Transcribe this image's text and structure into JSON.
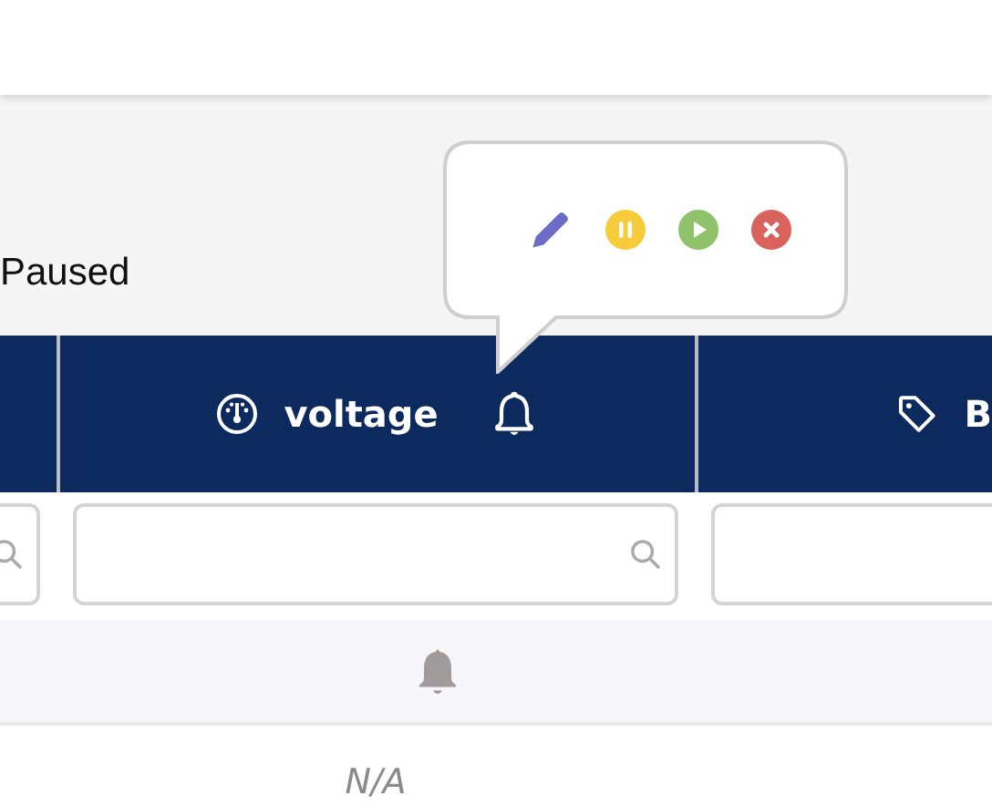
{
  "status_text": "Paused",
  "popover": {
    "actions": [
      {
        "kind": "edit"
      },
      {
        "kind": "pause"
      },
      {
        "kind": "play"
      },
      {
        "kind": "remove"
      }
    ]
  },
  "table": {
    "columns": [
      {
        "label": "voltage"
      },
      {
        "label": "B"
      }
    ],
    "rows": [
      {
        "cell": {
          "kind": "bell"
        }
      },
      {
        "cell": {
          "kind": "text",
          "text": "N/A"
        }
      }
    ]
  }
}
